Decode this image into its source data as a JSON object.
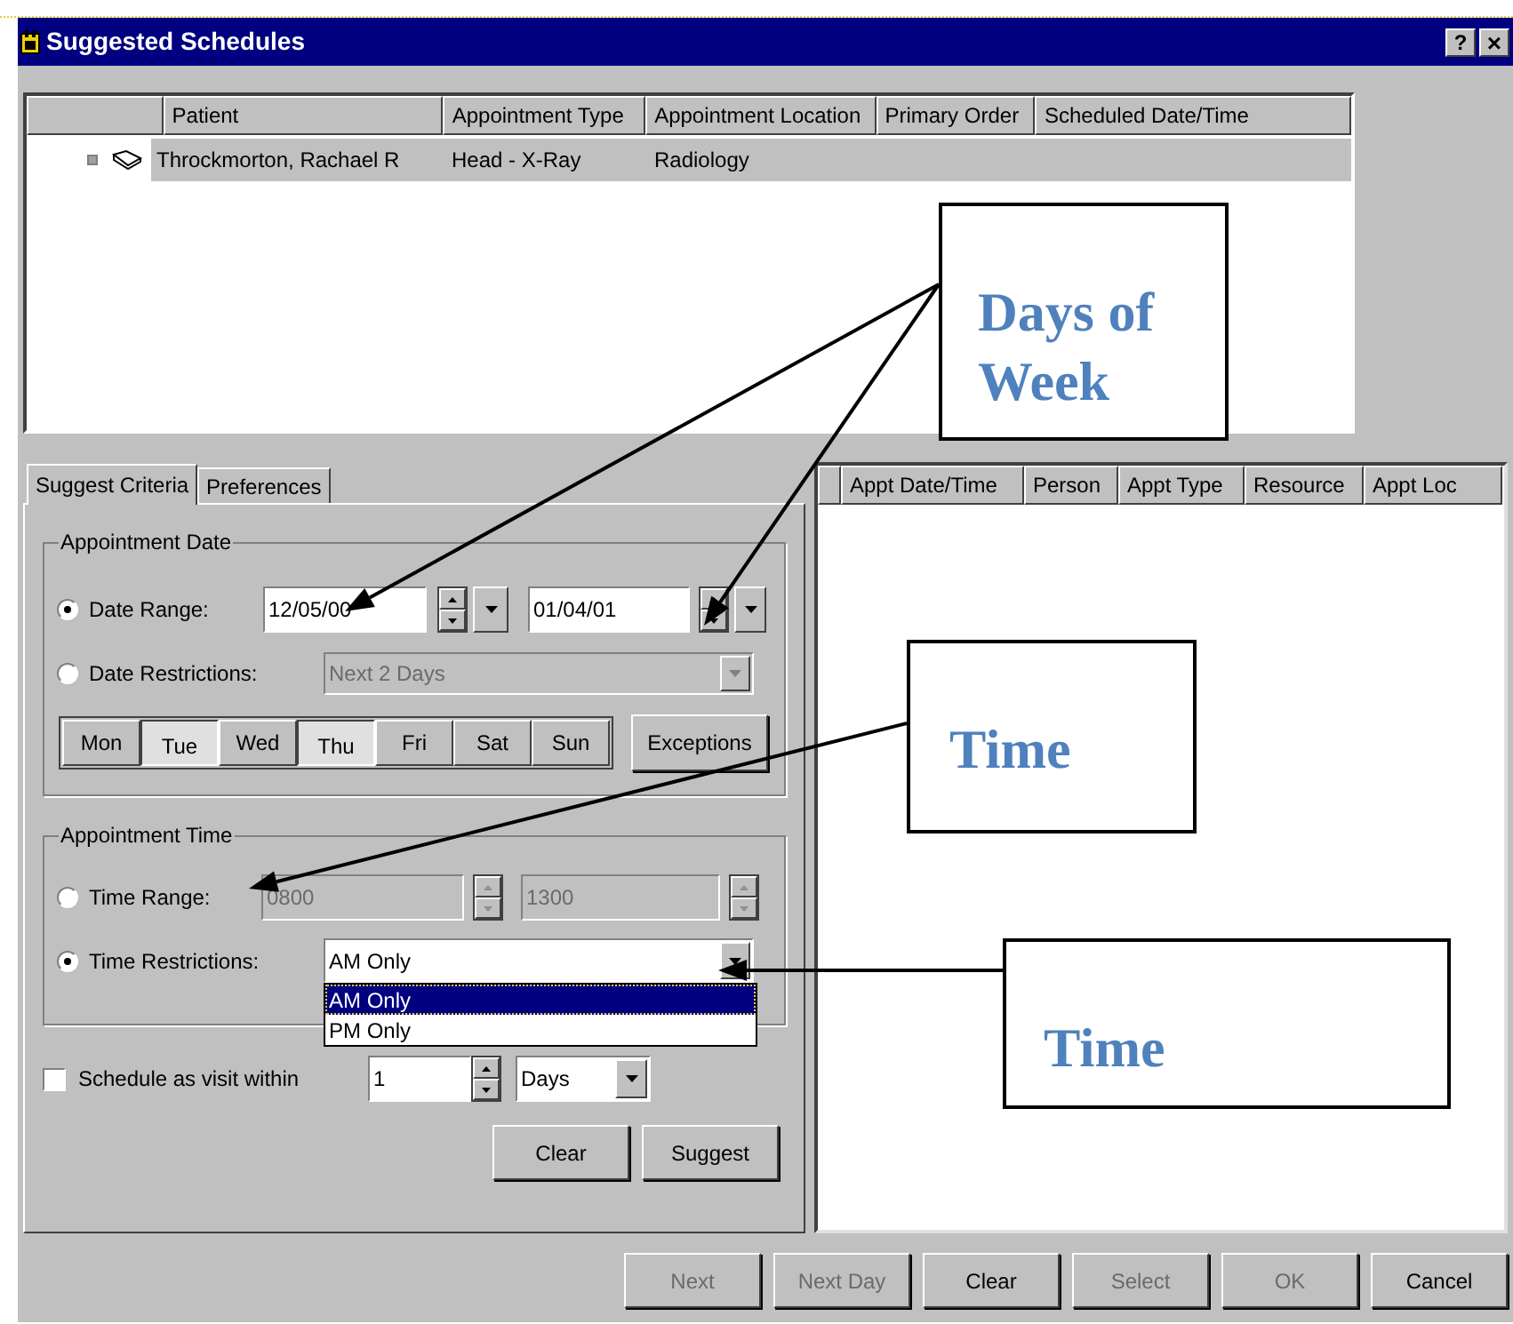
{
  "window": {
    "title": "Suggested Schedules",
    "help_button": "?",
    "close_button": "×"
  },
  "patients_list": {
    "columns": [
      "Patient",
      "Appointment Type",
      "Appointment Location",
      "Primary Order",
      "Scheduled Date/Time"
    ],
    "rows": [
      {
        "cells": [
          "Throckmorton, Rachael R",
          "Head - X-Ray",
          "Radiology"
        ],
        "selected": true
      }
    ]
  },
  "tabs": [
    {
      "label": "Suggest Criteria",
      "selected": true
    },
    {
      "label": "Preferences",
      "selected": false
    }
  ],
  "appointment_date": {
    "title": "Appointment Date",
    "options": [
      {
        "label": "Date Range:",
        "selected": true
      },
      {
        "label": "Date Restrictions:",
        "selected": false
      }
    ],
    "start_date": "12/05/00",
    "end_date": "01/04/01",
    "restriction": {
      "value": "Next 2 Days",
      "disabled": true
    },
    "days": [
      {
        "label": "Mon",
        "selected": false
      },
      {
        "label": "Tue",
        "selected": true
      },
      {
        "label": "Wed",
        "selected": false
      },
      {
        "label": "Thu",
        "selected": true
      },
      {
        "label": "Fri",
        "selected": false
      },
      {
        "label": "Sat",
        "selected": false
      },
      {
        "label": "Sun",
        "selected": false
      }
    ],
    "exceptions_button": "Exceptions"
  },
  "appointment_time": {
    "title": "Appointment Time",
    "options": [
      {
        "label": "Time Range:",
        "selected": false
      },
      {
        "label": "Time Restrictions:",
        "selected": true
      }
    ],
    "time_range": {
      "start": "0800",
      "end": "1300",
      "disabled": true
    },
    "restriction": "AM Only",
    "dropdown_items": [
      {
        "label": "AM Only",
        "selected": true
      },
      {
        "label": "PM Only",
        "selected": false
      }
    ]
  },
  "visit": {
    "label": "Schedule as visit within",
    "checked": false,
    "count": "1",
    "unit": "Days"
  },
  "criteria_buttons": [
    "Clear",
    "Suggest"
  ],
  "results_list": {
    "columns": [
      "Appt Date/Time",
      "Person",
      "Appt Type",
      "Resource",
      "Appt Loc"
    ]
  },
  "buttons": [
    {
      "label": "Next",
      "disabled": true
    },
    {
      "label": "Next Day",
      "disabled": true
    },
    {
      "label": "Clear",
      "disabled": false
    },
    {
      "label": "Select",
      "disabled": true
    },
    {
      "label": "OK",
      "disabled": true
    },
    {
      "label": "Cancel",
      "disabled": false
    }
  ],
  "annotations": [
    {
      "text": "Days of Week"
    },
    {
      "text": "Time"
    },
    {
      "text": "Time"
    }
  ]
}
